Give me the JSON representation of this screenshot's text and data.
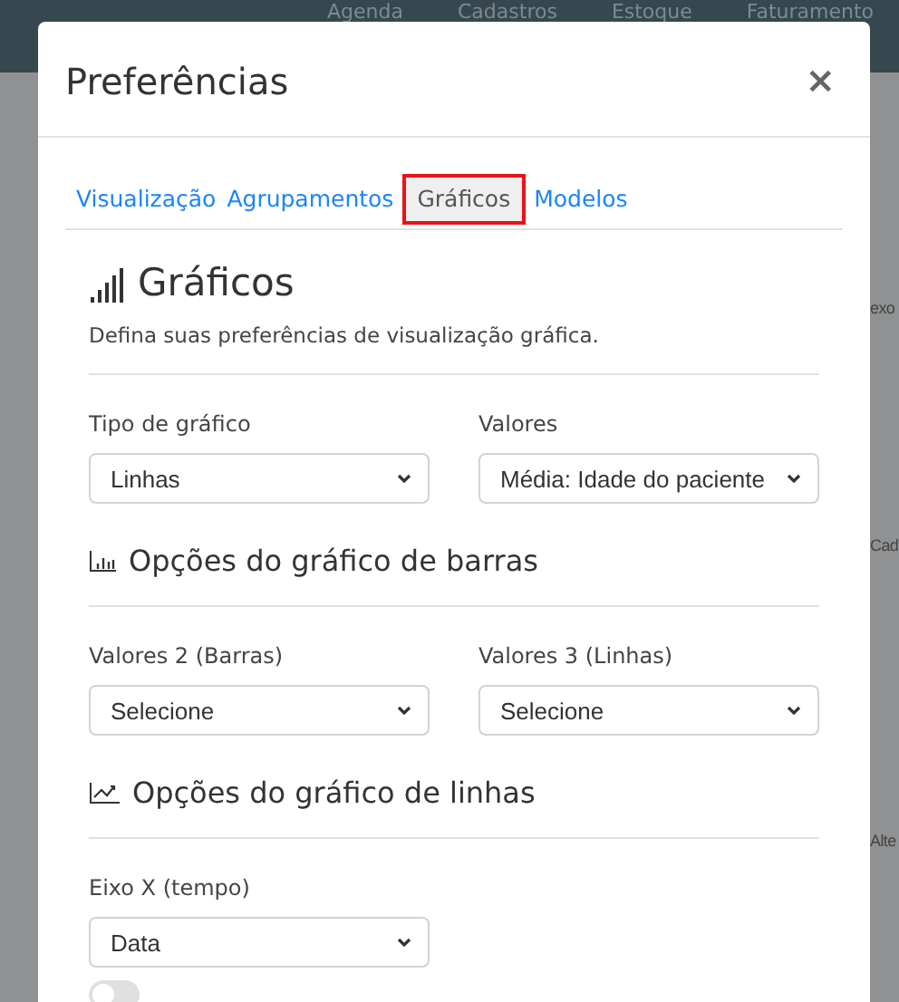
{
  "nav": [
    "Agenda",
    "Cadastros",
    "Estoque",
    "Faturamento"
  ],
  "background_texts": [
    "exo",
    "Cad",
    "Alte"
  ],
  "modal": {
    "title": "Preferências",
    "close": "×"
  },
  "tabs": [
    {
      "label": "Visualização",
      "selected": false
    },
    {
      "label": "Agrupamentos",
      "selected": false
    },
    {
      "label": "Gráficos",
      "selected": true
    },
    {
      "label": "Modelos",
      "selected": false
    }
  ],
  "heading": "Gráficos",
  "description": "Defina suas preferências de visualização gráfica.",
  "sections": [
    {
      "kind": "fields",
      "fields": [
        {
          "label": "Tipo de gráfico",
          "value": "Linhas"
        },
        {
          "label": "Valores",
          "value": "Média: Idade do paciente"
        }
      ]
    },
    {
      "kind": "heading",
      "title": "Opções do gráfico de barras"
    },
    {
      "kind": "fields",
      "fields": [
        {
          "label": "Valores 2 (Barras)",
          "value": "Selecione"
        },
        {
          "label": "Valores 3 (Linhas)",
          "value": "Selecione"
        }
      ]
    },
    {
      "kind": "heading",
      "title": "Opções do gráfico de linhas"
    },
    {
      "kind": "fields",
      "fields": [
        {
          "label": "Eixo X (tempo)",
          "value": "Data"
        }
      ]
    }
  ],
  "toggle": {
    "on": false
  }
}
